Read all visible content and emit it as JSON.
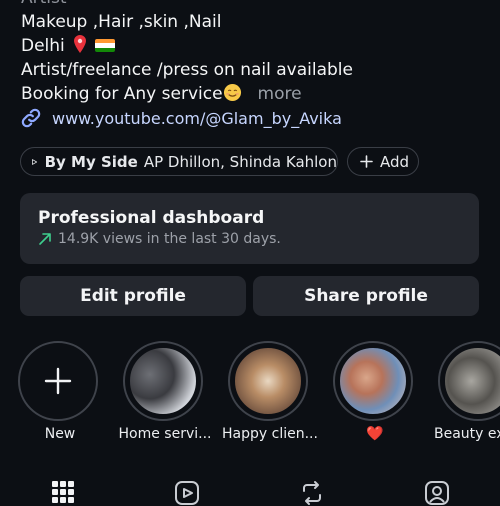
{
  "bio": {
    "category": "Artist",
    "line1": "Makeup ,Hair ,skin ,Nail",
    "line2": "Delhi",
    "line3": "Artist/freelance /press on nail available",
    "line4": "Booking for Any service",
    "more": "more"
  },
  "link": {
    "text": "www.youtube.com/@Glam_by_Avika",
    "icon": "link-icon"
  },
  "music": {
    "song": "By My Side",
    "artists": "AP Dhillon, Shinda Kahlon",
    "icon": "play-icon"
  },
  "add": {
    "label": "Add",
    "icon": "plus-icon"
  },
  "dashboard": {
    "title": "Professional dashboard",
    "subtitle": "14.9K views in the last 30 days."
  },
  "buttons": {
    "edit": "Edit profile",
    "share": "Share profile"
  },
  "highlights": [
    {
      "label": "New"
    },
    {
      "label": "Home servi..."
    },
    {
      "label": "Happy clien..."
    },
    {
      "label": "❤️"
    },
    {
      "label": "Beauty ex"
    }
  ],
  "tabs": [
    "grid-icon",
    "reels-icon",
    "reposts-icon",
    "tagged-icon"
  ],
  "colors": {
    "background": "#0c0f14",
    "card": "#24272e",
    "link": "#c7d6ff",
    "accent_arrow": "#3ecf8e"
  }
}
